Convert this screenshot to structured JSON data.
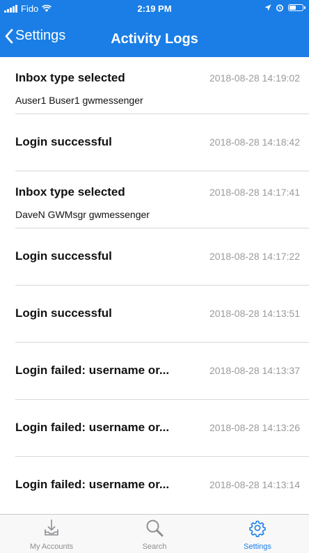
{
  "status_bar": {
    "carrier": "Fido",
    "time": "2:19 PM",
    "battery_level": 0.55
  },
  "nav": {
    "back_label": "Settings",
    "title": "Activity Logs"
  },
  "logs": [
    {
      "title": "Inbox type selected",
      "subtitle": "Auser1 Buser1 gwmessenger",
      "timestamp": "2018-08-28 14:19:02"
    },
    {
      "title": "Login successful",
      "subtitle": "",
      "timestamp": "2018-08-28 14:18:42"
    },
    {
      "title": "Inbox type selected",
      "subtitle": "DaveN GWMsgr gwmessenger",
      "timestamp": "2018-08-28 14:17:41"
    },
    {
      "title": "Login successful",
      "subtitle": "",
      "timestamp": "2018-08-28 14:17:22"
    },
    {
      "title": "Login successful",
      "subtitle": "",
      "timestamp": "2018-08-28 14:13:51"
    },
    {
      "title": "Login failed: username or...",
      "subtitle": "",
      "timestamp": "2018-08-28 14:13:37"
    },
    {
      "title": "Login failed: username or...",
      "subtitle": "",
      "timestamp": "2018-08-28 14:13:26"
    },
    {
      "title": "Login failed: username or...",
      "subtitle": "",
      "timestamp": "2018-08-28 14:13:14"
    }
  ],
  "tabs": [
    {
      "label": "My Accounts",
      "icon": "download-tray-icon",
      "active": false
    },
    {
      "label": "Search",
      "icon": "magnifier-icon",
      "active": false
    },
    {
      "label": "Settings",
      "icon": "gear-icon",
      "active": true
    }
  ],
  "colors": {
    "accent": "#1a7ee6",
    "timestamp": "#9a9a9a",
    "inactive_tab": "#8e8e93"
  }
}
